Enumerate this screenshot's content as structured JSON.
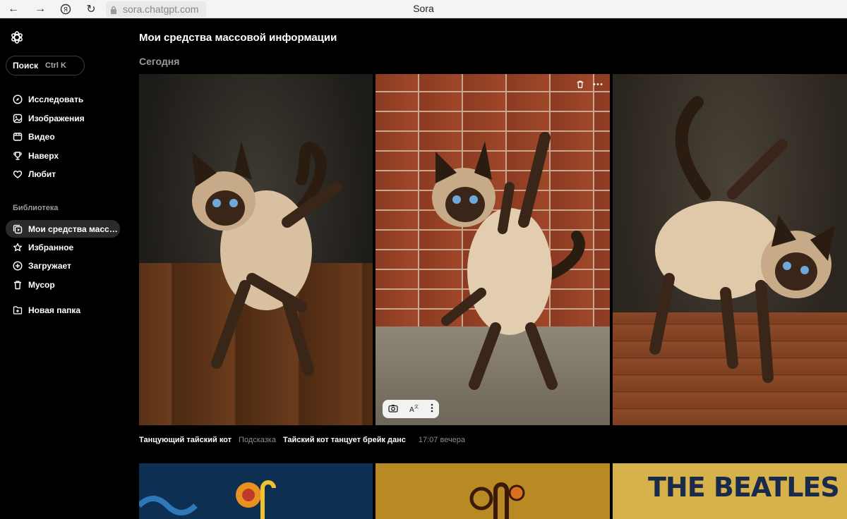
{
  "browser": {
    "url": "sora.chatgpt.com",
    "tab_title": "Sora"
  },
  "sidebar": {
    "search_label": "Поиск",
    "search_shortcut": "Ctrl K",
    "nav": [
      {
        "label": "Исследовать",
        "icon": "compass-icon"
      },
      {
        "label": "Изображения",
        "icon": "image-icon"
      },
      {
        "label": "Видео",
        "icon": "video-icon"
      },
      {
        "label": "Наверх",
        "icon": "trophy-icon"
      },
      {
        "label": "Любит",
        "icon": "heart-icon"
      }
    ],
    "library_label": "Библиотека",
    "library": [
      {
        "label": "Мои средства масс…",
        "icon": "media-icon",
        "active": true
      },
      {
        "label": "Избранное",
        "icon": "star-icon"
      },
      {
        "label": "Загружает",
        "icon": "upload-icon"
      },
      {
        "label": "Мусор",
        "icon": "trash-icon"
      }
    ],
    "new_folder": {
      "label": "Новая папка",
      "icon": "folder-plus-icon"
    }
  },
  "main": {
    "title": "Мои средства массовой информации",
    "day_label": "Сегодня",
    "group": {
      "title": "Танцующий тайский кот",
      "prompt_label": "Подсказка",
      "prompt": "Тайский кот танцует брейк данс",
      "time": "17:07 вечера"
    },
    "poster_text": "THE BEATLES YELLOW"
  }
}
